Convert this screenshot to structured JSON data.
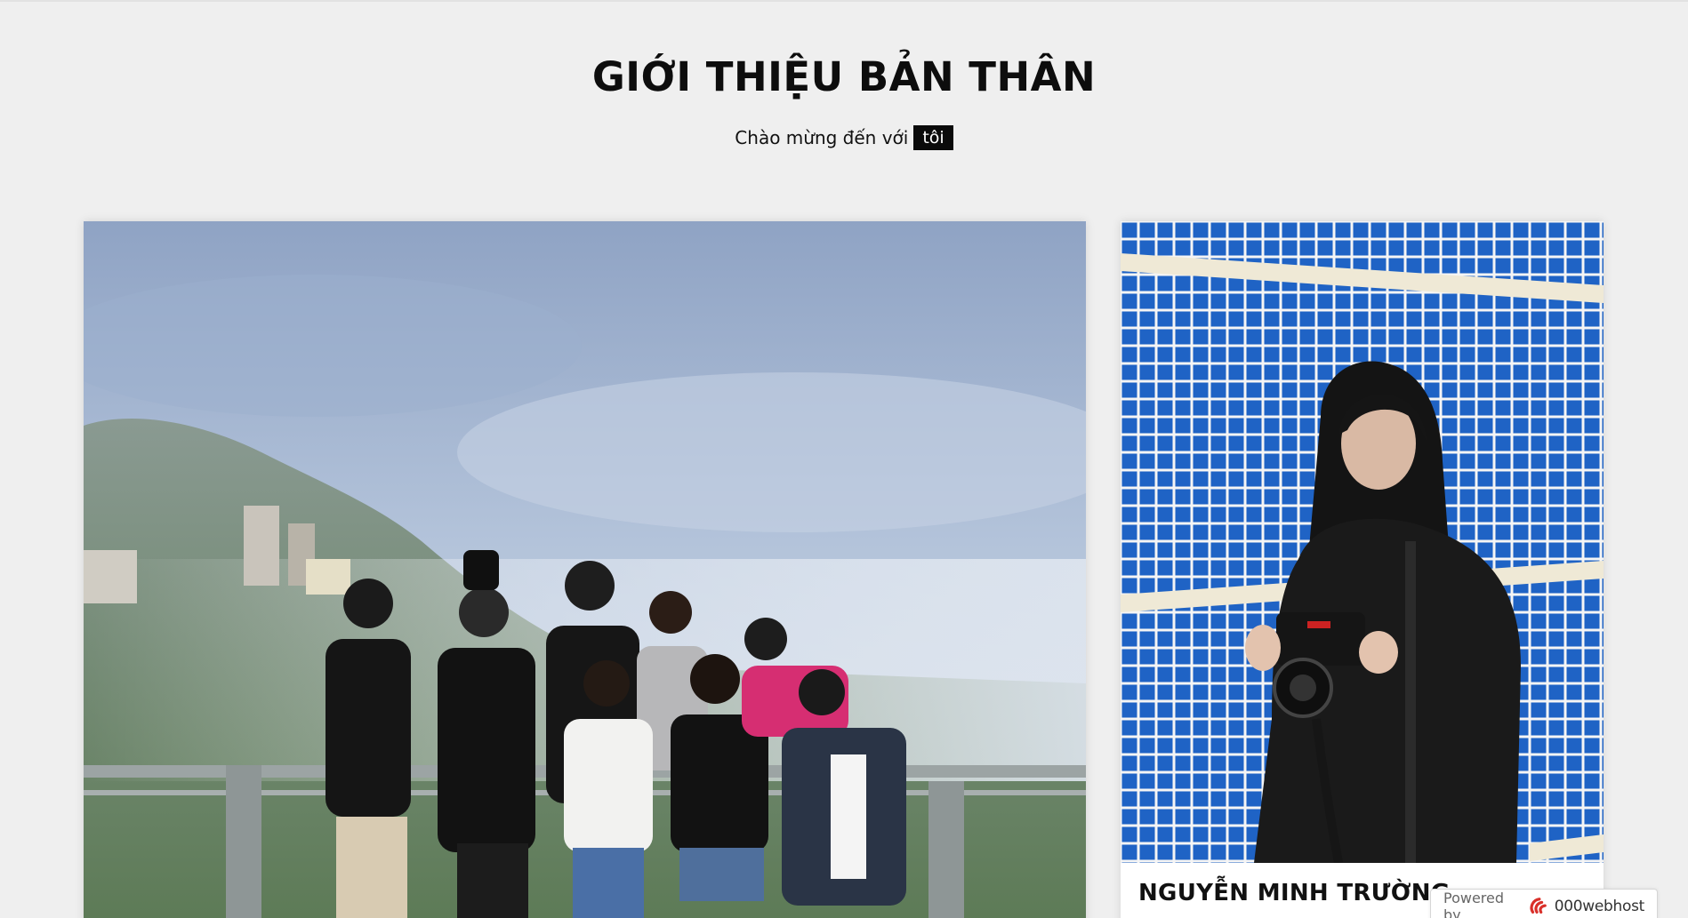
{
  "header": {
    "title": "GIỚI THIỆU BẢN THÂN",
    "subtitle_prefix": "Chào mừng đến với",
    "subtitle_highlight": "tôi"
  },
  "cards": {
    "main": {
      "image": "group-photo"
    },
    "side": {
      "image": "portrait-photo",
      "name": "NGUYỄN MINH TRƯỜNG"
    }
  },
  "footer_badge": {
    "label": "Powered by",
    "brand": "000webhost",
    "icon": "webhost-logo-icon"
  },
  "colors": {
    "background": "#efefef",
    "highlight_bg": "#0a0a0a",
    "tile_blue": "#1f63c5",
    "brand_red": "#d9302a"
  }
}
